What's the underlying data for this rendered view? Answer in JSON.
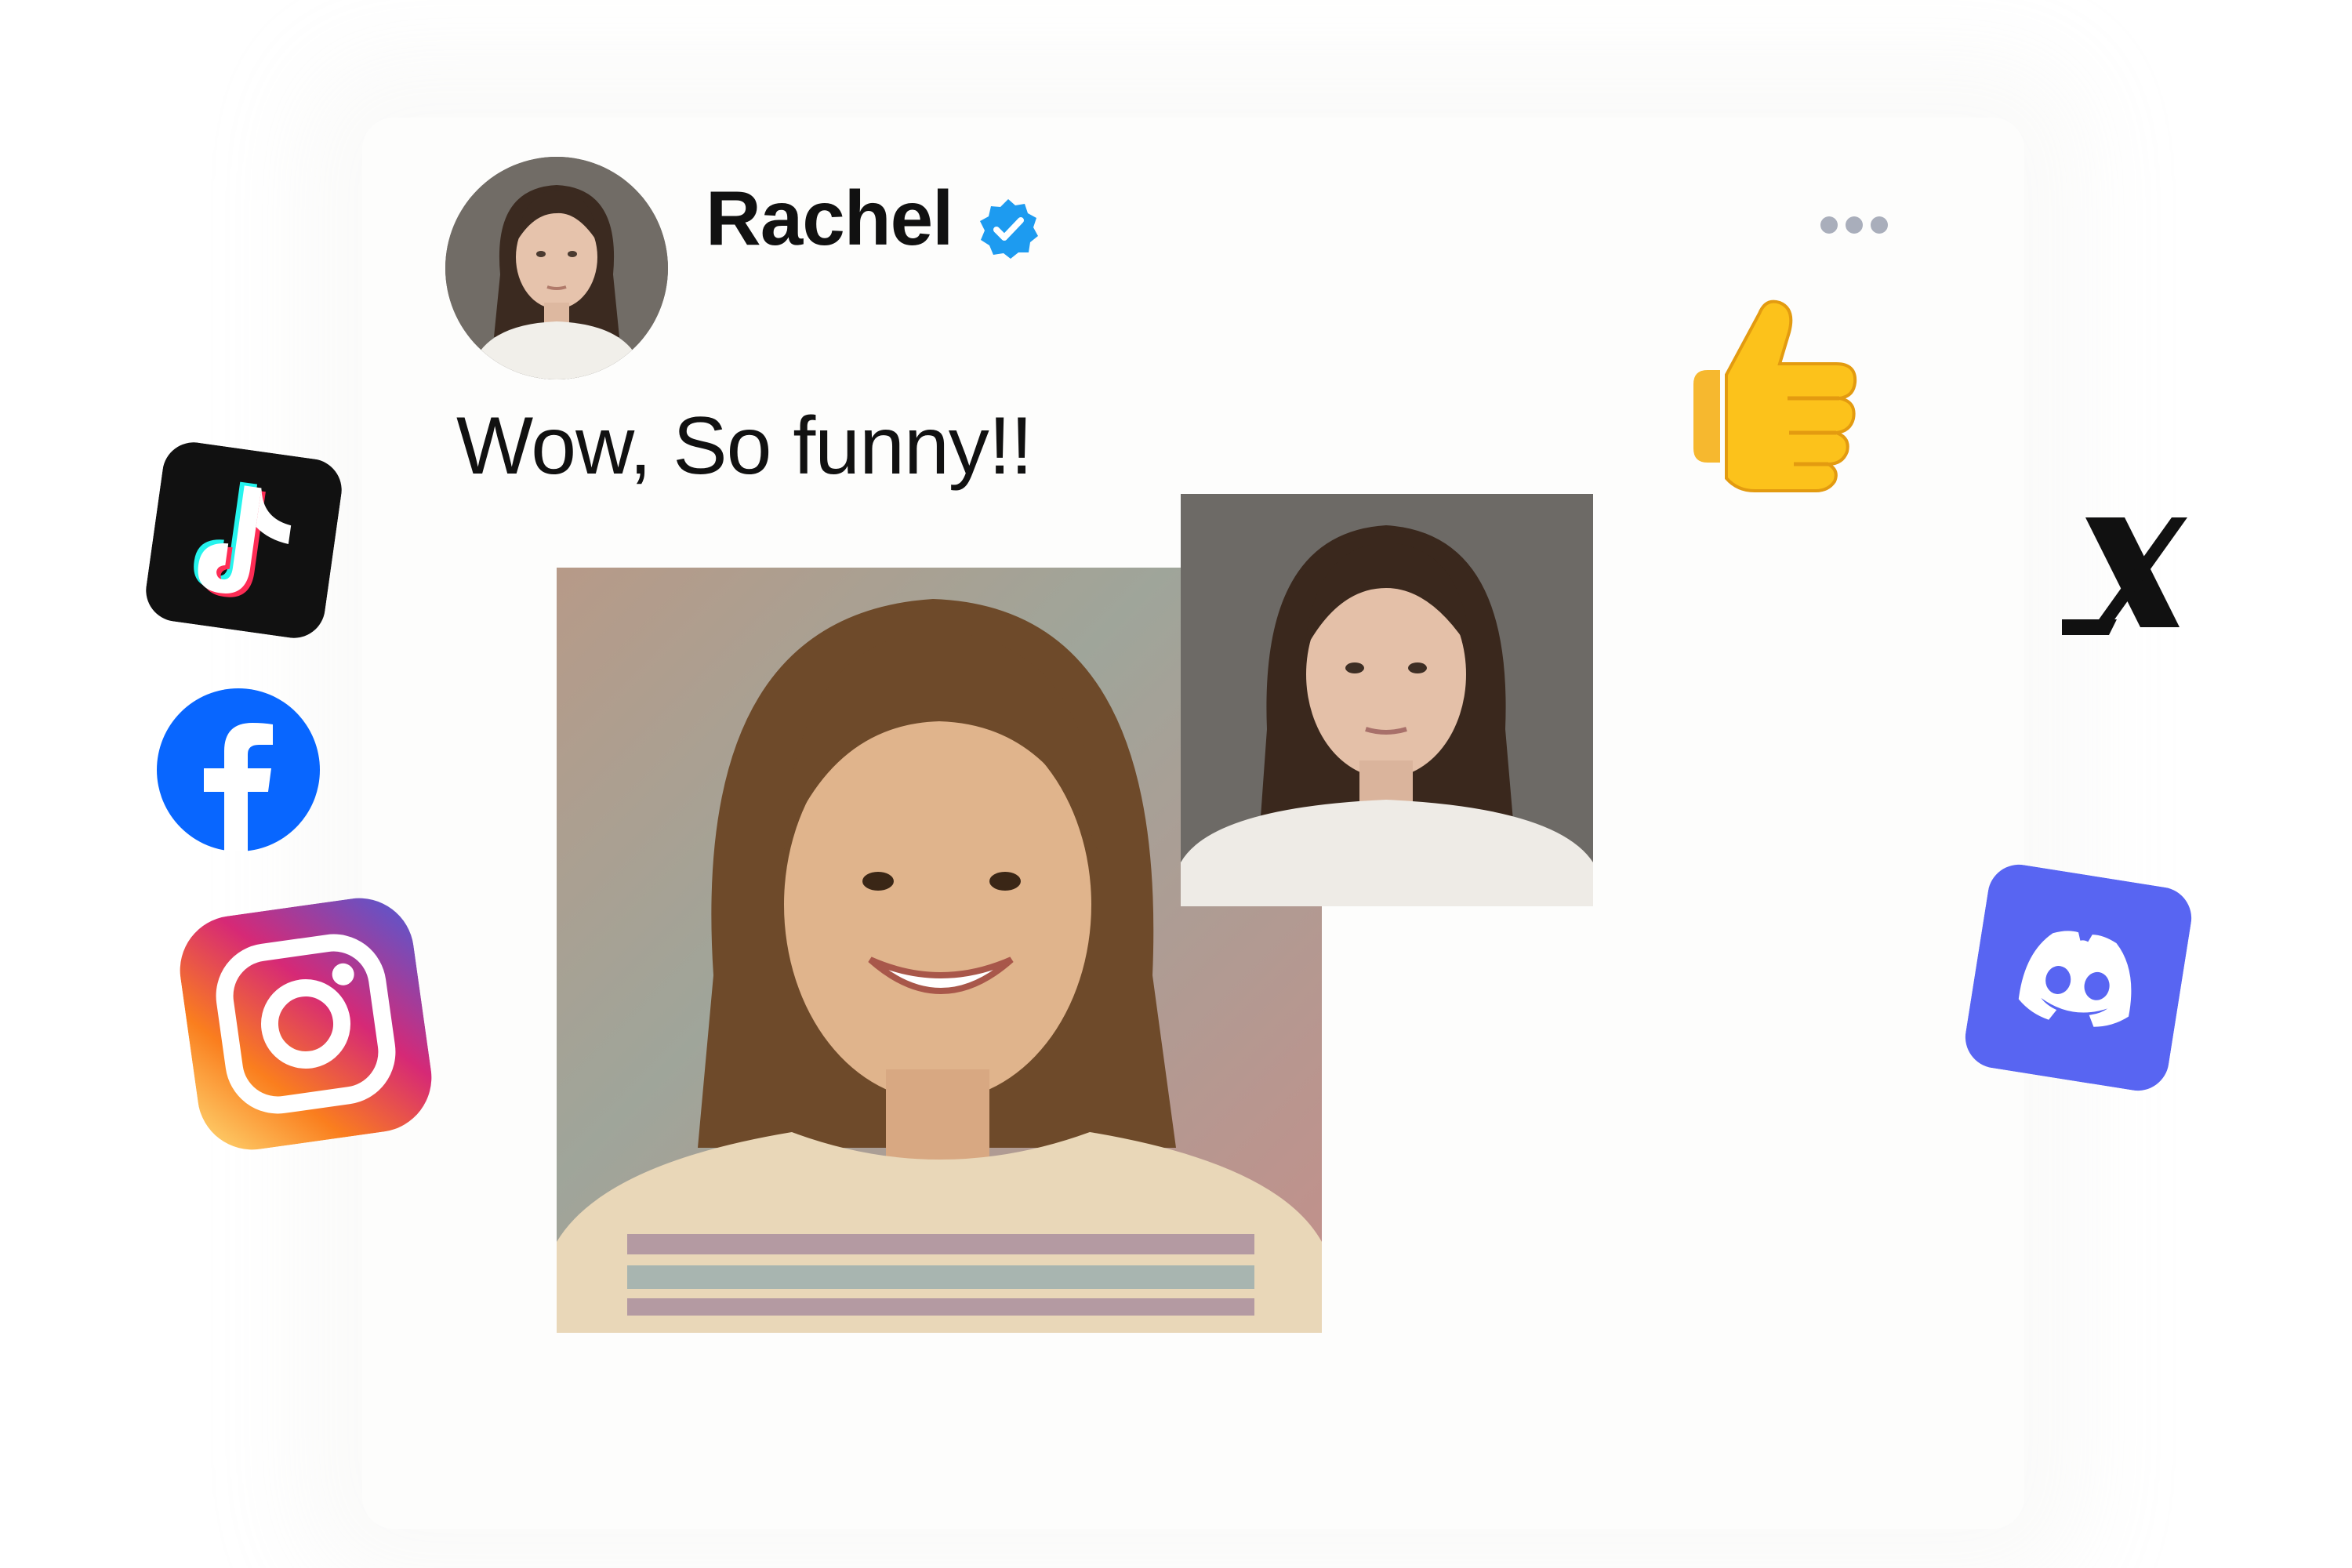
{
  "post": {
    "author": "Rachel",
    "verified": true,
    "text": "Wow, So funny!!"
  },
  "icons": {
    "verified": "verified-badge-icon",
    "more": "more-options-icon",
    "tiktok": "tiktok-icon",
    "facebook": "facebook-icon",
    "instagram": "instagram-icon",
    "thumbs_up": "thumbs-up-icon",
    "x": "x-logo-icon",
    "discord": "discord-icon"
  },
  "colors": {
    "verified": "#1d9bf0",
    "facebook": "#0866ff",
    "discord": "#5865f2",
    "tiktok_bg": "#111111"
  }
}
